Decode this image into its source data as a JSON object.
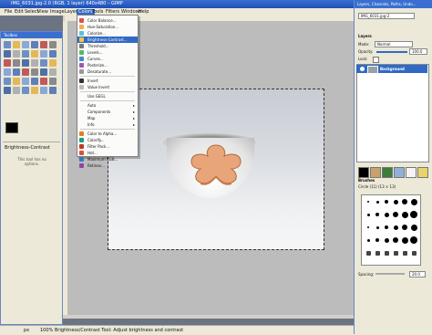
{
  "window": {
    "title": "IMG_6031.jpg-2.0 (RGB, 1 layer) 640x480 – GIMP"
  },
  "menubar": {
    "items": [
      "File",
      "Edit",
      "Select",
      "View",
      "Image",
      "Layer",
      "Colors",
      "Tools",
      "Filters",
      "Windows",
      "Help"
    ],
    "active": "Colors"
  },
  "colors_menu": {
    "items": [
      {
        "label": "Color Balance...",
        "submenu": false
      },
      {
        "label": "Hue-Saturation...",
        "submenu": false
      },
      {
        "label": "Colorize...",
        "submenu": false
      },
      {
        "label": "Brightness-Contrast...",
        "submenu": false,
        "highlighted": true
      },
      {
        "label": "Threshold...",
        "submenu": false
      },
      {
        "label": "Levels...",
        "submenu": false
      },
      {
        "label": "Curves...",
        "submenu": false
      },
      {
        "label": "Posterize...",
        "submenu": false
      },
      {
        "label": "Desaturate...",
        "submenu": false
      },
      {
        "label": "Invert",
        "submenu": false
      },
      {
        "label": "Value Invert",
        "submenu": false
      },
      {
        "label": "Use GEGL",
        "submenu": false
      },
      {
        "label": "Auto",
        "submenu": true
      },
      {
        "label": "Components",
        "submenu": true
      },
      {
        "label": "Map",
        "submenu": true
      },
      {
        "label": "Info",
        "submenu": true
      },
      {
        "label": "Color to Alpha...",
        "submenu": false
      },
      {
        "label": "Colorify...",
        "submenu": false
      },
      {
        "label": "Filter Pack...",
        "submenu": false
      },
      {
        "label": "Hot...",
        "submenu": false
      },
      {
        "label": "Maximum RGB...",
        "submenu": false
      },
      {
        "label": "Retinex...",
        "submenu": false
      }
    ]
  },
  "toolbox": {
    "title": "Toolbox",
    "tool_options_label": "Brightness-Contrast",
    "tool_options_hint": "This tool has no options."
  },
  "statusbar": {
    "unit": "px",
    "zoom": "100%",
    "message": "Brightness/Contrast Tool: Adjust brightness and contrast"
  },
  "dock": {
    "title": "Layers, Channels, Paths, Undo...",
    "image_selector": "IMG_6031.jpg-2",
    "layers_label": "Layers",
    "mode_label": "Mode:",
    "mode_value": "Normal",
    "opacity_label": "Opacity:",
    "opacity_value": "100.0",
    "lock_label": "Lock:",
    "layer_name": "Background",
    "brushes_label": "Brushes",
    "brush_name": "Circle (11) (13 × 13)",
    "spacing_label": "Spacing:",
    "spacing_value": "20.0"
  }
}
